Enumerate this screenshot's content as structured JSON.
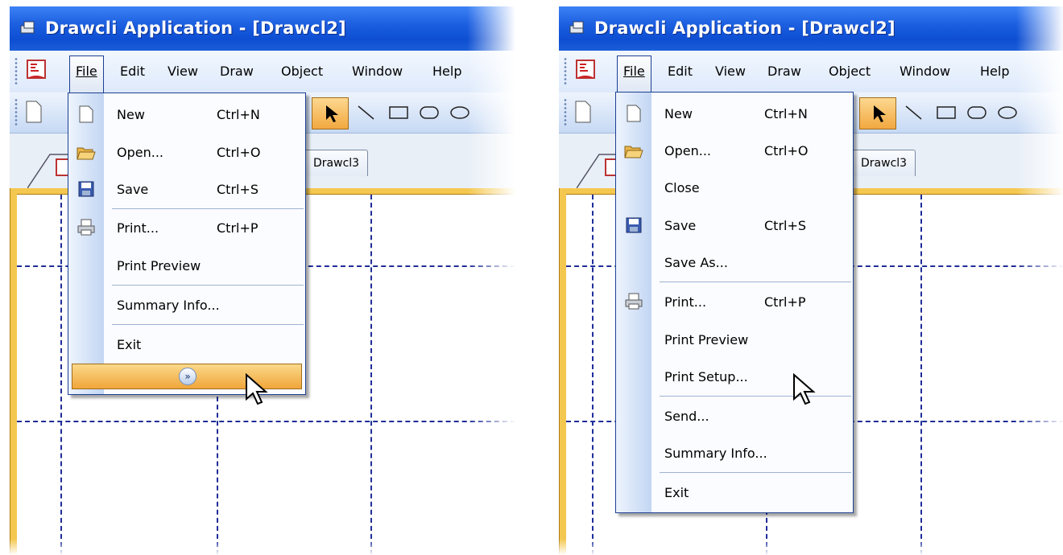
{
  "window": {
    "title": "Drawcli Application - [Drawcl2]"
  },
  "menubar": {
    "items": [
      "File",
      "Edit",
      "View",
      "Draw",
      "Object",
      "Window",
      "Help"
    ]
  },
  "tabs": {
    "doc3": "Drawcl3"
  },
  "left_menu": {
    "items": [
      {
        "label": "New",
        "shortcut": "Ctrl+N",
        "icon": "new-document-icon"
      },
      {
        "label": "Open...",
        "shortcut": "Ctrl+O",
        "icon": "open-folder-icon"
      },
      {
        "label": "Save",
        "shortcut": "Ctrl+S",
        "icon": "save-disk-icon"
      },
      {
        "label": "Print...",
        "shortcut": "Ctrl+P",
        "icon": "printer-icon"
      },
      {
        "label": "Print Preview",
        "shortcut": ""
      },
      {
        "label": "Summary Info...",
        "shortcut": ""
      },
      {
        "label": "Exit",
        "shortcut": ""
      }
    ],
    "expand_icon": "chevron-double-down-icon"
  },
  "right_menu": {
    "items": [
      {
        "label": "New",
        "shortcut": "Ctrl+N",
        "icon": "new-document-icon"
      },
      {
        "label": "Open...",
        "shortcut": "Ctrl+O",
        "icon": "open-folder-icon"
      },
      {
        "label": "Close",
        "shortcut": ""
      },
      {
        "label": "Save",
        "shortcut": "Ctrl+S",
        "icon": "save-disk-icon"
      },
      {
        "label": "Save As...",
        "shortcut": ""
      },
      {
        "label": "Print...",
        "shortcut": "Ctrl+P",
        "icon": "printer-icon"
      },
      {
        "label": "Print Preview",
        "shortcut": ""
      },
      {
        "label": "Print Setup...",
        "shortcut": ""
      },
      {
        "label": "Send...",
        "shortcut": ""
      },
      {
        "label": "Summary Info...",
        "shortcut": ""
      },
      {
        "label": "Exit",
        "shortcut": ""
      }
    ]
  },
  "colors": {
    "titlebar": "#1c5fe0",
    "highlight": "#f0a53a",
    "grid": "#1e2e98",
    "frame": "#f4c850"
  }
}
